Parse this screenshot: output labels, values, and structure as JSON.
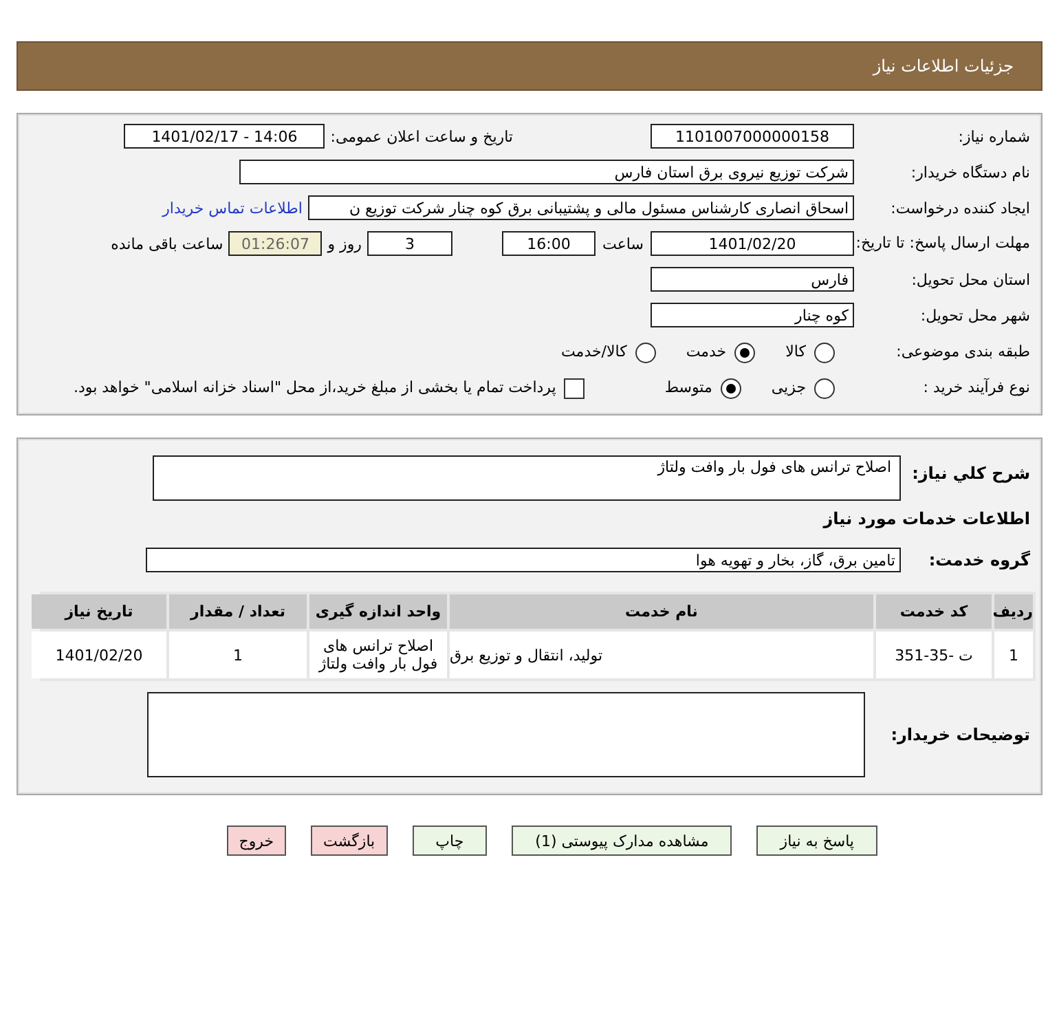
{
  "header": {
    "title": "جزئیات اطلاعات نیاز"
  },
  "details": {
    "need_number": {
      "label": "شماره نیاز:",
      "value": "1101007000000158"
    },
    "announce": {
      "label": "تاریخ و ساعت اعلان عمومی:",
      "value": "1401/02/17 - 14:06"
    },
    "buyer": {
      "label": "نام دستگاه خریدار:",
      "value": "شرکت توزیع نیروی برق استان فارس"
    },
    "creator": {
      "label": "ایجاد کننده درخواست:",
      "value": "اسحاق انصاری کارشناس مسئول مالی و پشتیبانی برق کوه چنار شرکت توزیع ن",
      "link": "اطلاعات تماس خریدار"
    },
    "deadline": {
      "label": "مهلت ارسال پاسخ: تا تاریخ:",
      "date": "1401/02/20",
      "time_label": "ساعت",
      "time": "16:00",
      "days": "3",
      "days_label": "روز و",
      "remaining": "01:26:07",
      "remaining_label": "ساعت باقی مانده"
    },
    "province": {
      "label": "استان محل تحویل:",
      "value": "فارس"
    },
    "city": {
      "label": "شهر محل تحویل:",
      "value": "کوه چنار"
    },
    "category": {
      "label": "طبقه بندی موضوعی:",
      "options": [
        {
          "label": "کالا",
          "selected": false
        },
        {
          "label": "خدمت",
          "selected": true
        },
        {
          "label": "کالا/خدمت",
          "selected": false
        }
      ]
    },
    "process": {
      "label": "نوع فرآیند خرید :",
      "options": [
        {
          "label": "جزیی",
          "selected": false
        },
        {
          "label": "متوسط",
          "selected": true
        }
      ],
      "payment": {
        "label": "پرداخت تمام یا بخشی از مبلغ خرید،از محل \"اسناد خزانه اسلامی\" خواهد بود.",
        "checked": false
      }
    }
  },
  "services": {
    "summary": {
      "label": "شرح کلي نياز:",
      "value": "اصلاح ترانس های فول بار وافت ولتاژ"
    },
    "heading": "اطلاعات خدمات مورد نیاز",
    "group": {
      "label": "گروه خدمت:",
      "value": "تامین برق، گاز، بخار و تهویه هوا"
    },
    "table": {
      "columns": [
        "ردیف",
        "کد خدمت",
        "نام خدمت",
        "واحد اندازه گیری",
        "تعداد / مقدار",
        "تاریخ نیاز"
      ],
      "rows": [
        [
          "1",
          "ت -35-351",
          "تولید، انتقال و توزیع برق",
          "اصلاح ترانس های فول بار وافت ولتاژ",
          "1",
          "1401/02/20"
        ]
      ]
    },
    "notes": {
      "label": "توضیحات خریدار:"
    }
  },
  "buttons": [
    {
      "label": "پاسخ به نیاز",
      "kind": "action"
    },
    {
      "label": "مشاهده مدارک پیوستی (1)",
      "kind": "action"
    },
    {
      "label": "چاپ",
      "kind": "action"
    },
    {
      "label": "بازگشت",
      "kind": "danger"
    },
    {
      "label": "خروج",
      "kind": "danger"
    }
  ]
}
